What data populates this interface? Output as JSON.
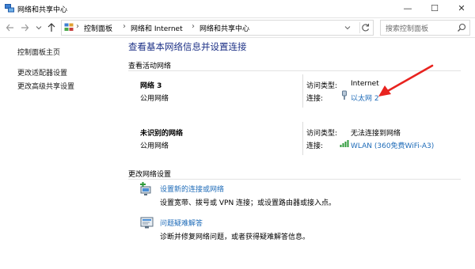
{
  "window": {
    "title": "网络和共享中心",
    "controls": {
      "minimize": "—",
      "maximize": "☐",
      "close": "✕"
    }
  },
  "nav": {
    "back_icon": "back-arrow-icon",
    "forward_icon": "forward-arrow-icon",
    "recent_icon": "chevron-down-icon",
    "up_icon": "up-arrow-icon",
    "breadcrumb": [
      "控制面板",
      "网络和 Internet",
      "网络和共享中心"
    ],
    "search_placeholder": "搜索控制面板"
  },
  "sidebar": {
    "items": [
      {
        "label": "控制面板主页"
      },
      {
        "label": "更改适配器设置"
      },
      {
        "label": "更改高级共享设置"
      }
    ]
  },
  "main": {
    "title": "查看基本网络信息并设置连接",
    "active_networks_header": "查看活动网络",
    "networks": [
      {
        "name": "网络 3",
        "type": "公用网络",
        "access_label": "访问类型:",
        "access_value": "Internet",
        "connection_label": "连接:",
        "connection_value": "以太网 2",
        "connection_icon": "ethernet-icon"
      },
      {
        "name": "未识别的网络",
        "type": "公用网络",
        "access_label": "访问类型:",
        "access_value": "无法连接到网络",
        "connection_label": "连接:",
        "connection_value": "WLAN (360免费WiFi-A3)",
        "connection_icon": "wifi-signal-icon"
      }
    ],
    "change_settings_header": "更改网络设置",
    "actions": [
      {
        "title": "设置新的连接或网络",
        "description": "设置宽带、拨号或 VPN 连接；或设置路由器或接入点。",
        "icon": "new-connection-icon"
      },
      {
        "title": "问题疑难解答",
        "description": "诊断并修复网络问题，或者获得疑难解答信息。",
        "icon": "troubleshoot-icon"
      }
    ]
  },
  "colors": {
    "link": "#1e6bb8",
    "title": "#1e3287",
    "annotation_arrow": "#e8231f"
  }
}
